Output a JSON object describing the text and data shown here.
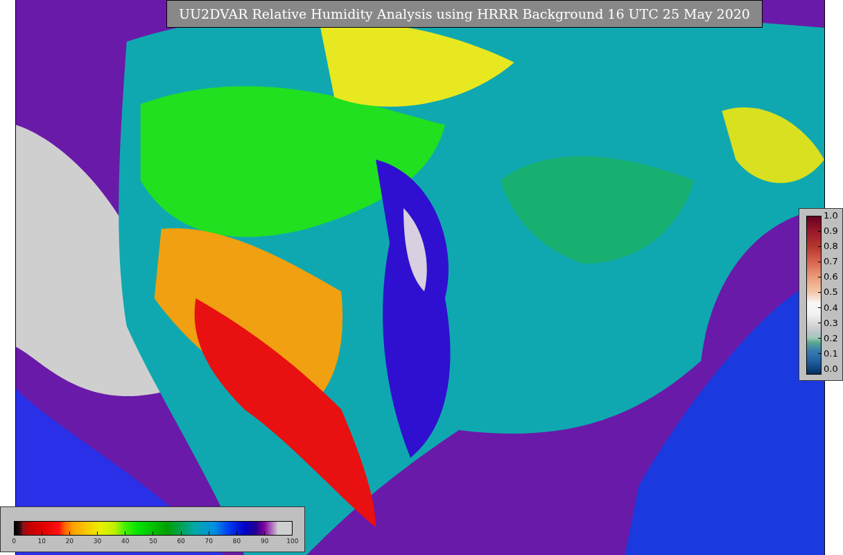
{
  "title": "UU2DVAR Relative Humidity Analysis using HRRR Background 16 UTC 25 May 2020",
  "observation_legend": {
    "ticks": [
      "1.0",
      "0.9",
      "0.8",
      "0.7",
      "0.6",
      "0.5",
      "0.4",
      "0.3",
      "0.2",
      "0.1",
      "0.0"
    ]
  },
  "humidity_legend": {
    "ticks": [
      "0",
      "10",
      "20",
      "30",
      "40",
      "50",
      "60",
      "70",
      "80",
      "90",
      "100"
    ]
  }
}
